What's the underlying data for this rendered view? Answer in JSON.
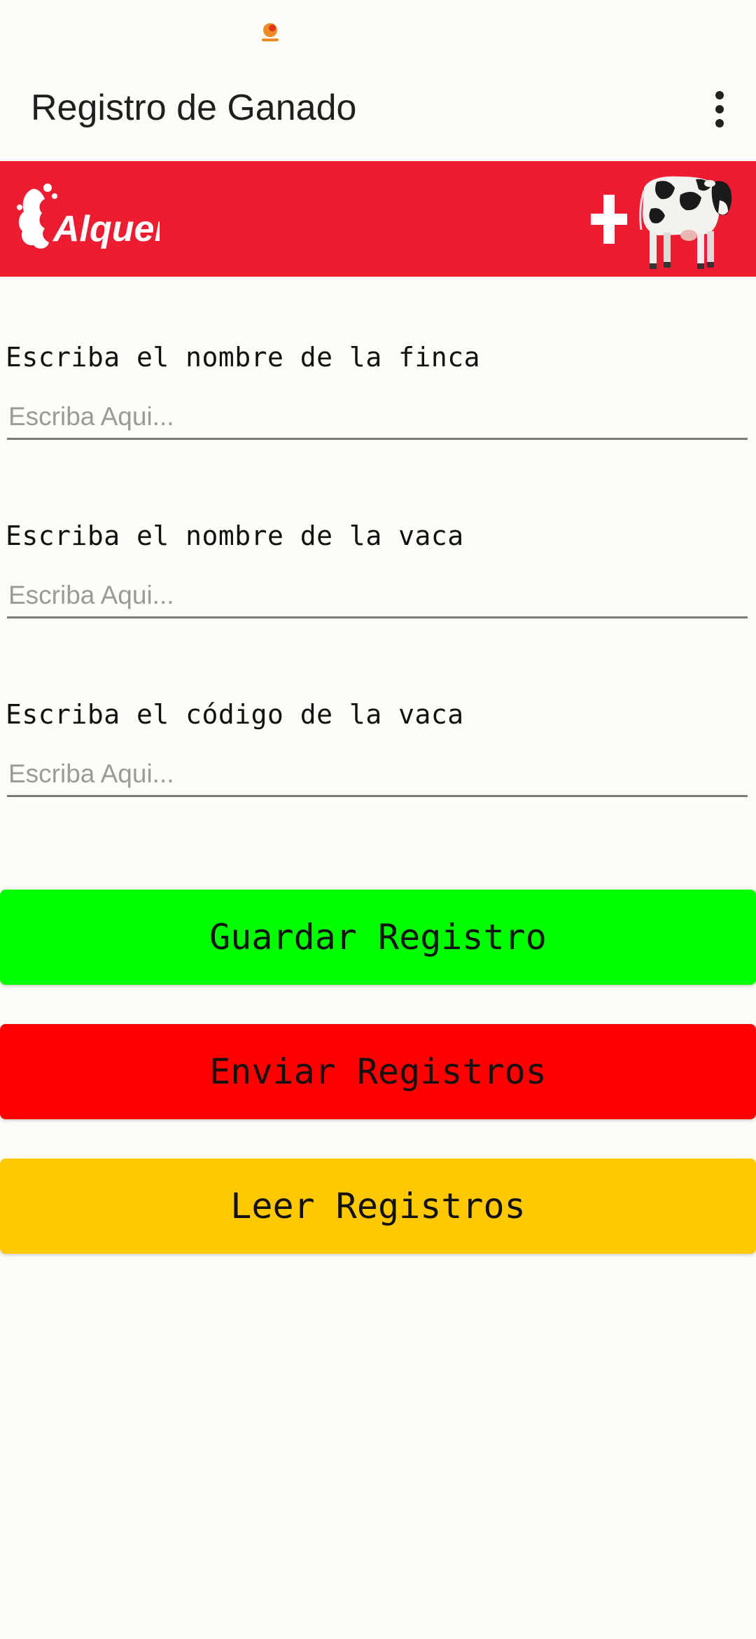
{
  "app": {
    "title": "Registro de Ganado",
    "menu_icon": "more-vert-icon"
  },
  "status_bar": {
    "notification_icon": "orange-dot-icon"
  },
  "banner": {
    "logo_text": "Alquería",
    "plus_icon": "plus-icon",
    "cow_icon": "cow-icon",
    "background_color": "#ed1c30"
  },
  "form": {
    "fields": [
      {
        "label": "Escriba el nombre de la finca",
        "placeholder": "Escriba Aqui...",
        "value": ""
      },
      {
        "label": "Escriba el nombre de la vaca",
        "placeholder": "Escriba Aqui...",
        "value": ""
      },
      {
        "label": "Escriba el código de la vaca",
        "placeholder": "Escriba Aqui...",
        "value": ""
      }
    ]
  },
  "buttons": [
    {
      "label": "Guardar Registro",
      "color": "#00ff00"
    },
    {
      "label": "Enviar Registros",
      "color": "#ff0000"
    },
    {
      "label": "Leer Registros",
      "color": "#ffc800"
    }
  ]
}
